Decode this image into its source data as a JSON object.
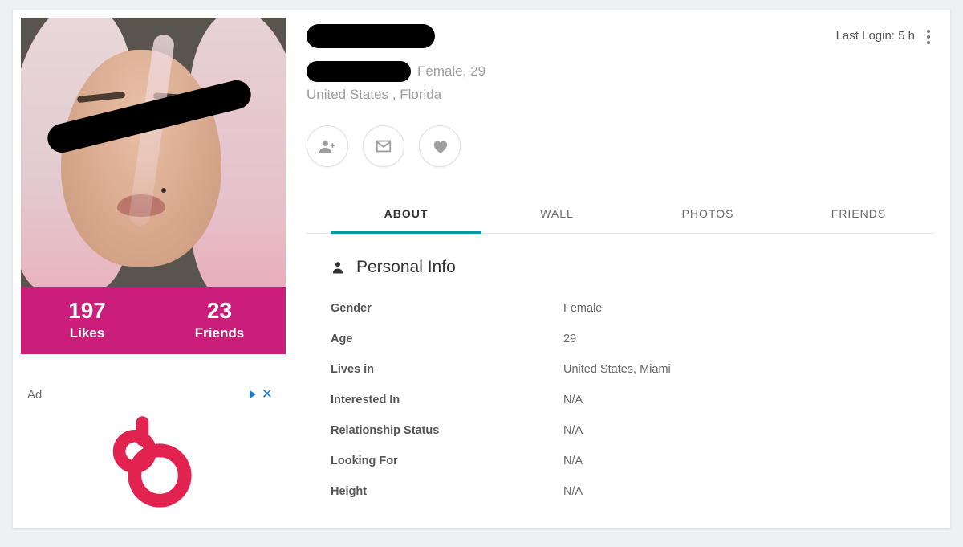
{
  "meta": {
    "last_login_label": "Last Login: 5 h"
  },
  "profile": {
    "sub_line": "Female, 29",
    "location": "United States , Florida"
  },
  "stats": {
    "likes_count": "197",
    "likes_label": "Likes",
    "friends_count": "23",
    "friends_label": "Friends"
  },
  "actions": {
    "add_friend": "Add friend",
    "message": "Message",
    "like": "Like"
  },
  "tabs": {
    "about": "ABOUT",
    "wall": "WALL",
    "photos": "PHOTOS",
    "friends": "FRIENDS"
  },
  "section": {
    "title": "Personal Info",
    "rows": [
      {
        "key": "Gender",
        "val": "Female"
      },
      {
        "key": "Age",
        "val": "29"
      },
      {
        "key": "Lives in",
        "val": "United States, Miami"
      },
      {
        "key": "Interested In",
        "val": "N/A"
      },
      {
        "key": "Relationship Status",
        "val": "N/A"
      },
      {
        "key": "Looking For",
        "val": "N/A"
      },
      {
        "key": "Height",
        "val": "N/A"
      }
    ]
  },
  "ad": {
    "label": "Ad"
  }
}
